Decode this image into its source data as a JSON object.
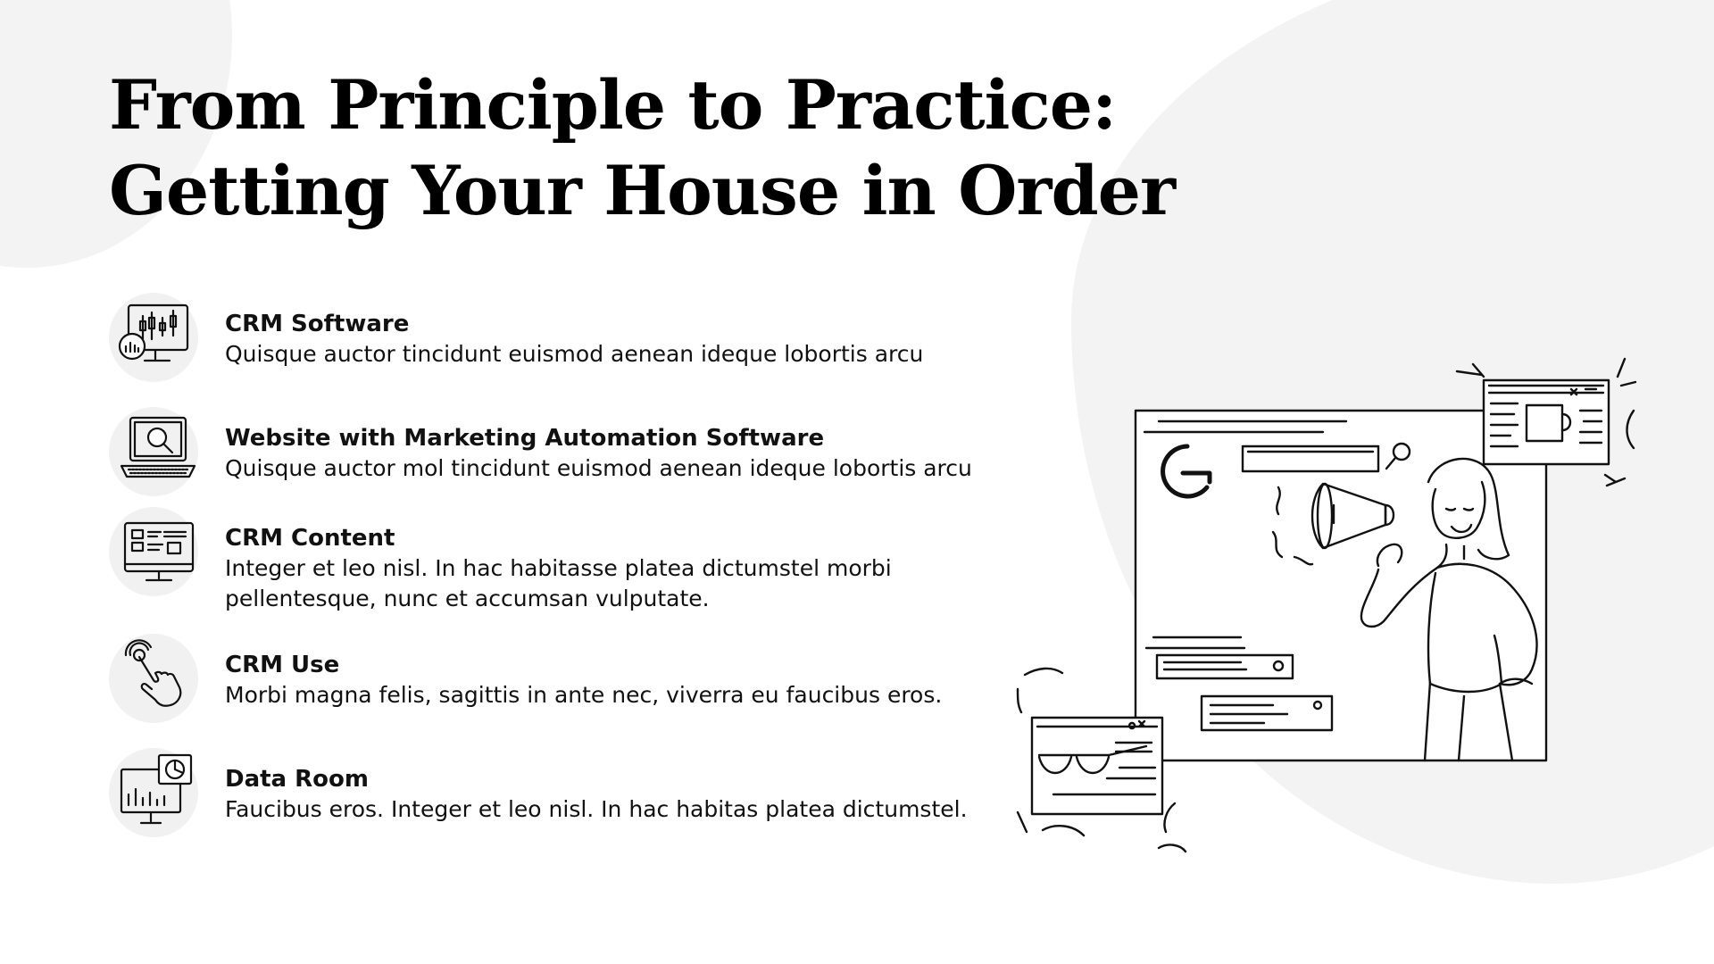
{
  "slide": {
    "title_line1": "From Principle to Practice:",
    "title_line2": "Getting Your House in Order",
    "items": [
      {
        "icon": "stock-chart-monitor-icon",
        "title": "CRM Software",
        "description": "Quisque auctor tincidunt euismod aenean ideque  lobortis arcu"
      },
      {
        "icon": "laptop-search-icon",
        "title": "Website with Marketing Automation Software",
        "description": "Quisque auctor mol tincidunt euismod aenean ideque lobortis arcu"
      },
      {
        "icon": "monitor-layout-icon",
        "title": "CRM Content",
        "description": "Integer et leo nisl. In hac habitasse platea dictumstel morbi pellentesque, nunc et accumsan vulputate."
      },
      {
        "icon": "hand-touch-icon",
        "title": "CRM Use",
        "description": "Morbi magna felis, sagittis in ante nec, viverra eu faucibus eros."
      },
      {
        "icon": "dashboard-presentation-icon",
        "title": "Data Room",
        "description": "Faucibus eros. Integer et leo nisl. In hac habitas platea dictumstel."
      }
    ],
    "illustration": "woman-with-megaphone-browser-illustration",
    "colors": {
      "background": "#ffffff",
      "blob": "#f3f3f3",
      "text": "#111111",
      "line_art": "#111111"
    }
  }
}
